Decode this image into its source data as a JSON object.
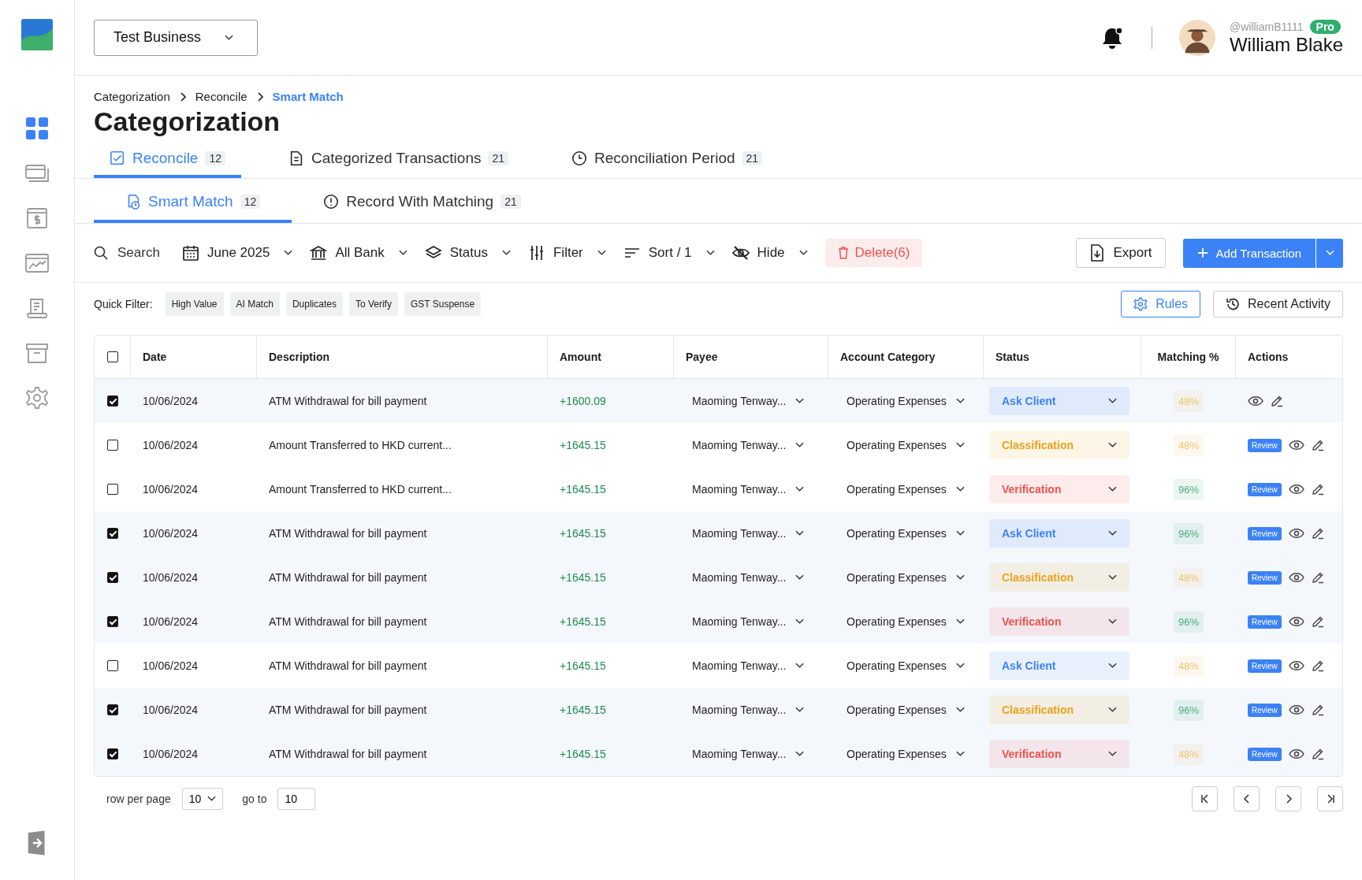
{
  "business_selector": {
    "value": "Test Business"
  },
  "user": {
    "handle": "@williamB1111",
    "badge": "Pro",
    "name": "William Blake"
  },
  "breadcrumb": [
    {
      "label": "Categorization",
      "selected": false
    },
    {
      "label": "Reconcile",
      "selected": false
    },
    {
      "label": "Smart Match",
      "selected": true
    }
  ],
  "page_title": "Categorization",
  "tabs": [
    {
      "label": "Reconcile",
      "count": "12",
      "selected": true
    },
    {
      "label": "Categorized Transactions",
      "count": "21",
      "selected": false
    },
    {
      "label": "Reconciliation Period",
      "count": "21",
      "selected": false
    }
  ],
  "subtabs": [
    {
      "label": "Smart Match",
      "count": "12",
      "selected": true
    },
    {
      "label": "Record With Matching",
      "count": "21",
      "selected": false
    }
  ],
  "toolbar": {
    "search": {
      "placeholder": "Search"
    },
    "filters": [
      "June 2025",
      "All Bank",
      "Status",
      "Filter",
      "Sort / 1",
      "Hide"
    ],
    "delete_button": "Delete(6)",
    "export_button": "Export",
    "add_button": "Add Transaction"
  },
  "quick_filter": {
    "label": "Quick Filter:",
    "chips": [
      "High Value",
      "AI Match",
      "Duplicates",
      "To Verify",
      "GST Suspense"
    ]
  },
  "rules_button": "Rules",
  "recent_activity_button": "Recent Activity",
  "table": {
    "columns": [
      "Date",
      "Description",
      "Amount",
      "Payee",
      "Account Category",
      "Status",
      "Matching %",
      "Actions"
    ],
    "select_all_checked": false,
    "rows": [
      {
        "checked": true,
        "date": "10/06/2024",
        "description": "ATM Withdrawal for bill payment",
        "amount": "+1600.09",
        "payee": "Maoming Tenway...",
        "category": "Operating Expenses",
        "status": {
          "label": "Ask Client",
          "color": "#3b82f6"
        },
        "matching": {
          "label": "48%",
          "color": "#f0c36a"
        }
      },
      {
        "checked": false,
        "date": "10/06/2024",
        "description": "Amount Transferred to HKD current...",
        "amount": "+1645.15",
        "payee": "Maoming Tenway...",
        "category": "Operating Expenses",
        "status": {
          "label": "Classification",
          "color": "#eaa21c"
        },
        "matching": {
          "label": "48%",
          "color": "#f0c36a"
        },
        "review": "Review"
      },
      {
        "checked": false,
        "date": "10/06/2024",
        "description": "Amount Transferred to HKD current...",
        "amount": "+1645.15",
        "payee": "Maoming Tenway...",
        "category": "Operating Expenses",
        "status": {
          "label": "Verification",
          "color": "#ef5350"
        },
        "matching": {
          "label": "96%",
          "color": "#4caf7a"
        },
        "review": "Review"
      },
      {
        "checked": true,
        "date": "10/06/2024",
        "description": "ATM Withdrawal for bill payment",
        "amount": "+1645.15",
        "payee": "Maoming Tenway...",
        "category": "Operating Expenses",
        "status": {
          "label": "Ask Client",
          "color": "#3b82f6"
        },
        "matching": {
          "label": "96%",
          "color": "#4caf7a"
        },
        "review": "Review"
      },
      {
        "checked": true,
        "date": "10/06/2024",
        "description": "ATM Withdrawal for bill payment",
        "amount": "+1645.15",
        "payee": "Maoming Tenway...",
        "category": "Operating Expenses",
        "status": {
          "label": "Classification",
          "color": "#eaa21c"
        },
        "matching": {
          "label": "48%",
          "color": "#f0c36a"
        },
        "review": "Review"
      },
      {
        "checked": true,
        "date": "10/06/2024",
        "description": "ATM Withdrawal for bill payment",
        "amount": "+1645.15",
        "payee": "Maoming Tenway...",
        "category": "Operating Expenses",
        "status": {
          "label": "Verification",
          "color": "#ef5350"
        },
        "matching": {
          "label": "96%",
          "color": "#4caf7a"
        },
        "review": "Review"
      },
      {
        "checked": false,
        "date": "10/06/2024",
        "description": "ATM Withdrawal for bill payment",
        "amount": "+1645.15",
        "payee": "Maoming Tenway...",
        "category": "Operating Expenses",
        "status": {
          "label": "Ask Client",
          "color": "#3b82f6"
        },
        "matching": {
          "label": "48%",
          "color": "#f0c36a"
        },
        "review": "Review"
      },
      {
        "checked": true,
        "date": "10/06/2024",
        "description": "ATM Withdrawal for bill payment",
        "amount": "+1645.15",
        "payee": "Maoming Tenway...",
        "category": "Operating Expenses",
        "status": {
          "label": "Classification",
          "color": "#eaa21c"
        },
        "matching": {
          "label": "96%",
          "color": "#4caf7a"
        },
        "review": "Review"
      },
      {
        "checked": true,
        "date": "10/06/2024",
        "description": "ATM Withdrawal for bill payment",
        "amount": "+1645.15",
        "payee": "Maoming Tenway...",
        "category": "Operating Expenses",
        "status": {
          "label": "Verification",
          "color": "#ef5350"
        },
        "matching": {
          "label": "48%",
          "color": "#f0c36a"
        },
        "review": "Review"
      }
    ]
  },
  "pagination": {
    "rows_label": "row per page",
    "rows_value": "10",
    "goto_label": "go to",
    "goto_value": "10"
  }
}
